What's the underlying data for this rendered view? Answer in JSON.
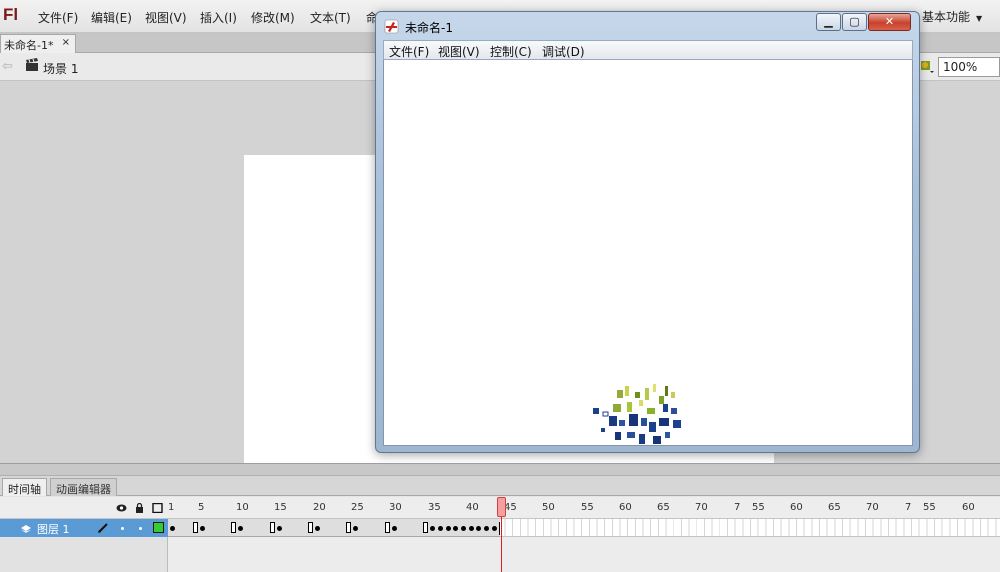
{
  "app": {
    "logo": "Fl",
    "menus": [
      "文件(F)",
      "编辑(E)",
      "视图(V)",
      "插入(I)",
      "修改(M)",
      "文本(T)",
      "命"
    ],
    "workspace": "基本功能"
  },
  "document": {
    "tab_title": "未命名-1*",
    "tab_close": "×",
    "scene_label": "场景 1",
    "zoom": "100%"
  },
  "timeline": {
    "tabs": [
      "时间轴",
      "动画编辑器"
    ],
    "ruler_numbers": [
      "1",
      "5",
      "10",
      "15",
      "20",
      "25",
      "30",
      "35",
      "40",
      "45",
      "50",
      "55",
      "60",
      "65",
      "70",
      "7",
      "55",
      "60",
      "65",
      "70",
      "7",
      "55",
      "60"
    ],
    "layer_name": "图层 1",
    "current_frame": 45
  },
  "player_window": {
    "title": "未命名-1",
    "menus": [
      "文件(F)",
      "视图(V)",
      "控制(C)",
      "调试(D)"
    ]
  },
  "colors": {
    "layer_selected": "#5b9bd5",
    "outline_swatch": "#33cc33",
    "playhead": "#e02020",
    "logo": "#7a1b1b"
  }
}
